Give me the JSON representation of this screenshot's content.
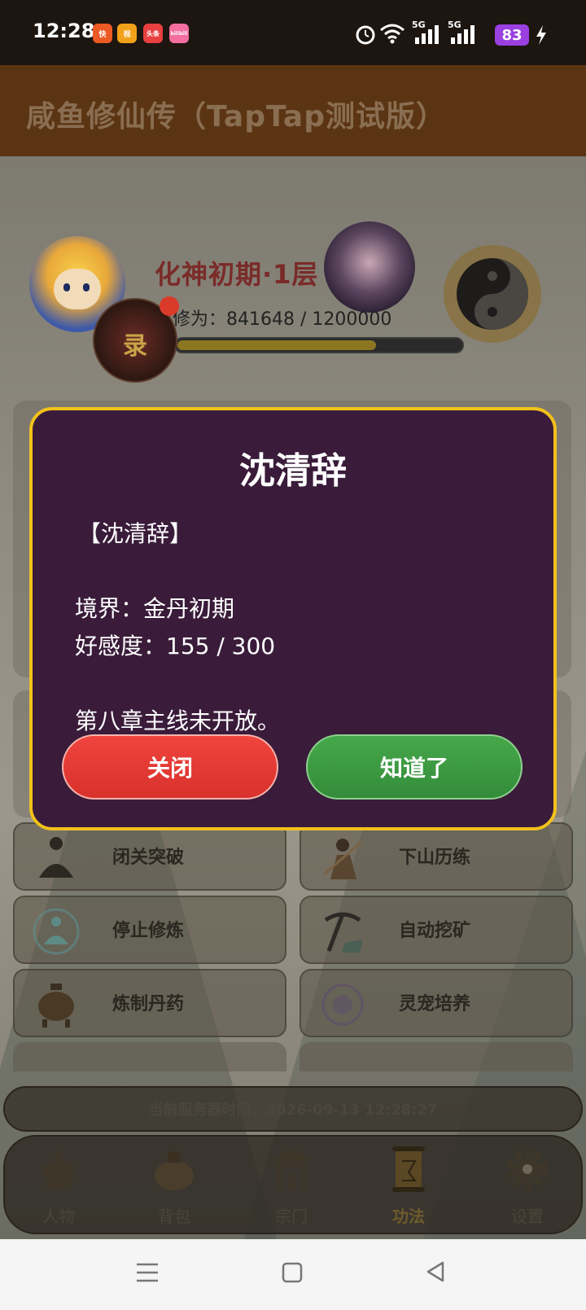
{
  "status_bar": {
    "time": "12:28",
    "apps": [
      "快",
      "视",
      "头条",
      "bilibili"
    ],
    "network": [
      "5G",
      "5G"
    ],
    "battery": "83"
  },
  "app": {
    "title": "咸鱼修仙传（TapTap测试版）"
  },
  "profile": {
    "realm": "化神初期·1层",
    "cultivation": "修为：841648 / 1200000",
    "progress": 0.701,
    "record_label": "录"
  },
  "features": [
    {
      "label": "闭关突破",
      "icon": "meditating-figure-icon"
    },
    {
      "label": "下山历练",
      "icon": "warrior-icon"
    },
    {
      "label": "停止修炼",
      "icon": "meditation-aura-icon"
    },
    {
      "label": "自动挖矿",
      "icon": "pickaxe-icon"
    },
    {
      "label": "炼制丹药",
      "icon": "cauldron-icon"
    },
    {
      "label": "灵宠培养",
      "icon": "spirit-pet-icon"
    }
  ],
  "server_time": "当前服务器时间：2026-09-13 12:28:27",
  "tabs": [
    {
      "label": "人物",
      "icon": "character-icon"
    },
    {
      "label": "背包",
      "icon": "bag-icon"
    },
    {
      "label": "宗门",
      "icon": "sect-gate-icon"
    },
    {
      "label": "功法",
      "icon": "scroll-icon",
      "active": true
    },
    {
      "label": "设置",
      "icon": "gear-icon"
    }
  ],
  "dialog": {
    "title": "沈清辞",
    "name_line": "【沈清辞】",
    "realm_line": "境界：金丹初期",
    "favor_line": "好感度：155 / 300",
    "note_line": "第八章主线未开放。",
    "close_label": "关闭",
    "ok_label": "知道了"
  },
  "colors": {
    "dialog_bg": "#3a1c3a",
    "dialog_border": "#f2c21b",
    "close_button": "#e83a35",
    "ok_button": "#3f9c45"
  }
}
